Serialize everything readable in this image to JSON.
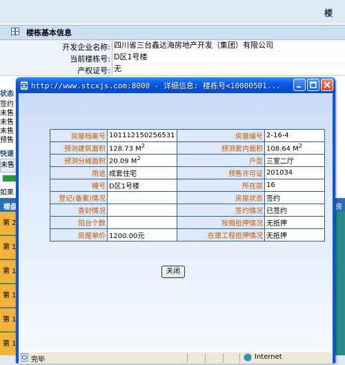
{
  "background_page": {
    "top_title": "楼",
    "section_title": "楼栋基本信息",
    "developer_label": "开发企业名称:",
    "developer_value": "四川省三台鑫达海房地产开发（集团）有限公司",
    "building_label": "当前楼栋号:",
    "building_value": "D区1号楼",
    "cert_label": "产权证号:",
    "cert_value": "无",
    "status_title": "状态",
    "status_items": [
      "签约",
      "未售",
      "未售",
      "未售",
      "预售"
    ],
    "quick_title": "快速",
    "quick_box": "未售",
    "if_text": "如果",
    "grid_header_left": "楼盘",
    "grid_header_right": "房",
    "floor_labels": [
      "第 2",
      "第 1",
      "第 1",
      "第 1",
      "第 1",
      "第 1"
    ]
  },
  "popup": {
    "title": "http://www.stcxjs.com:8000 - 详细信息: 楼栋号<10000501...",
    "detail_rows": [
      {
        "l1": "房屋档案号",
        "v1": "101112150256531",
        "l2": "房屋编号",
        "v2": "2-16-4"
      },
      {
        "l1": "预测建筑面积",
        "v1": "128.73 M",
        "s1": "2",
        "l2": "预测套内面积",
        "v2": "108.64 M",
        "s2": "2"
      },
      {
        "l1": "预测分摊面积",
        "v1": "20.09 M",
        "s1": "2",
        "l2": "户型",
        "v2": "三室二厅",
        "s2": ""
      },
      {
        "l1": "用途",
        "v1": "成套住宅",
        "l2": "预售许可证",
        "v2": "201034"
      },
      {
        "l1": "幢号",
        "v1": "D区1号楼",
        "l2": "所在层",
        "v2": "16"
      },
      {
        "l1": "登记(备案)情况",
        "v1": "",
        "l2": "房屋状态",
        "v2": "签约"
      },
      {
        "l1": "查封情况",
        "v1": "",
        "l2": "签约情况",
        "v2": "已签约"
      },
      {
        "l1": "阳台个数",
        "v1": "",
        "l2": "按揭抵押情况",
        "v2": "无抵押"
      },
      {
        "l1": "房屋单价",
        "v1": "1200.00元",
        "l2": "在建工程抵押情况",
        "v2": "无抵押"
      }
    ],
    "close_label": "关闭",
    "status_text": "完毕",
    "zone_text": "Internet",
    "icons": {
      "title": "ie-page-icon",
      "status": "ie-done-icon",
      "zone": "internet-globe-icon"
    }
  }
}
